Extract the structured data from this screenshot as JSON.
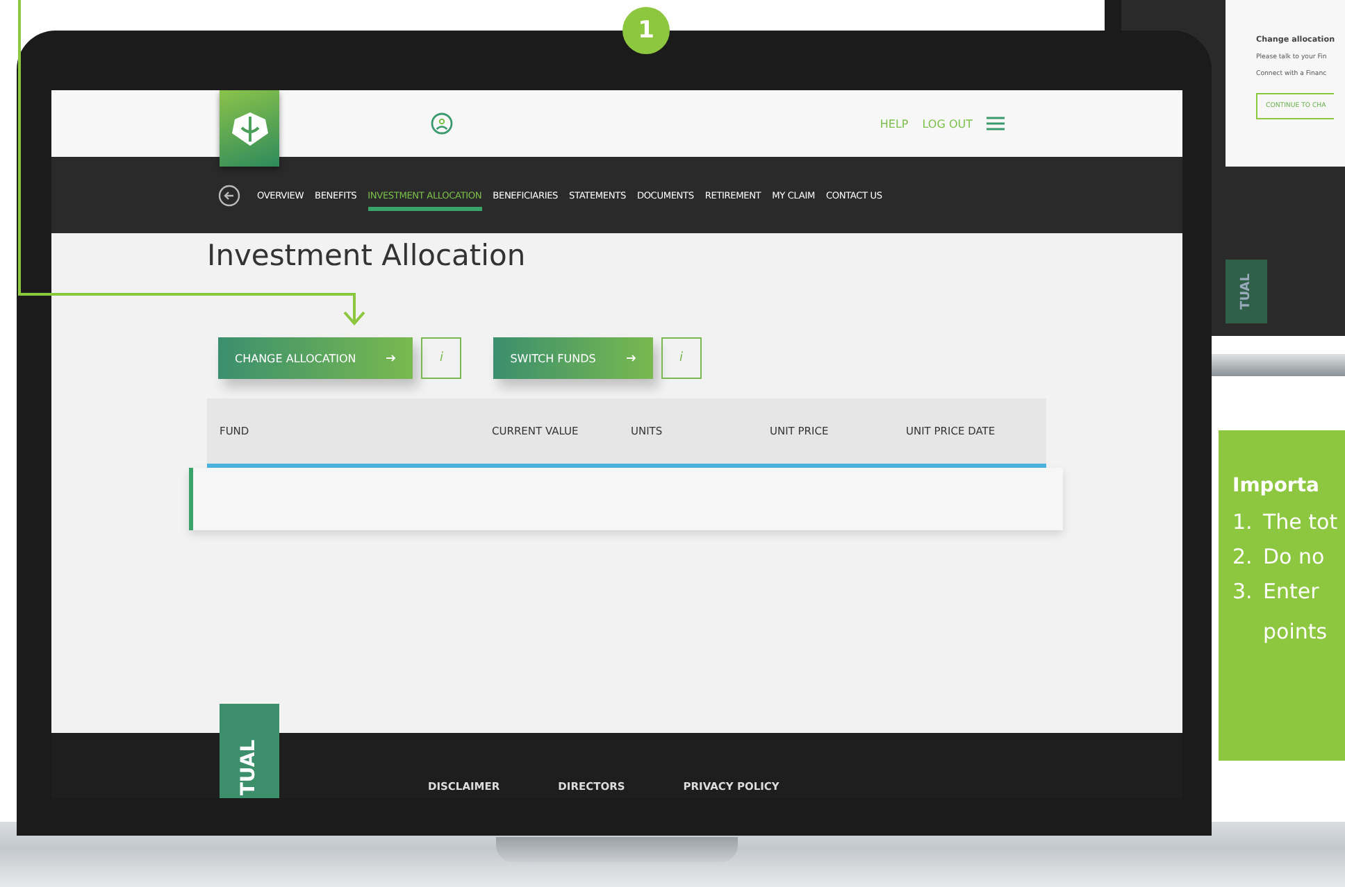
{
  "step_badge": {
    "text": "1"
  },
  "header": {
    "links": [
      {
        "label": "HELP"
      },
      {
        "label": "LOG OUT"
      }
    ]
  },
  "nav": {
    "items": [
      {
        "label": "OVERVIEW",
        "selected": false
      },
      {
        "label": "BENEFITS",
        "selected": false
      },
      {
        "label": "INVESTMENT ALLOCATION",
        "selected": true
      },
      {
        "label": "BENEFICIARIES",
        "selected": false
      },
      {
        "label": "STATEMENTS",
        "selected": false
      },
      {
        "label": "DOCUMENTS",
        "selected": false
      },
      {
        "label": "RETIREMENT",
        "selected": false
      },
      {
        "label": "MY CLAIM",
        "selected": false
      },
      {
        "label": "CONTACT US",
        "selected": false
      }
    ]
  },
  "page_title": "Investment Allocation",
  "actions": [
    {
      "label": "CHANGE ALLOCATION",
      "info": "i"
    },
    {
      "label": "SWITCH FUNDS",
      "info": "i"
    }
  ],
  "table": {
    "columns": [
      "FUND",
      "CURRENT VALUE",
      "UNITS",
      "UNIT PRICE",
      "UNIT PRICE DATE"
    ]
  },
  "brand_tab": "TUAL",
  "footer": {
    "links": [
      "DISCLAIMER",
      "DIRECTORS",
      "PRIVACY POLICY"
    ]
  },
  "second_laptop": {
    "modal": {
      "title": "Change allocation",
      "lines": [
        "Please talk to your Fin",
        "Connect with a Financ"
      ],
      "button": "CONTINUE TO CHA"
    },
    "brand_tab": "TUAL"
  },
  "note": {
    "title": "Importa",
    "items": [
      {
        "number": "1.",
        "lines": [
          "The tot"
        ]
      },
      {
        "number": "2.",
        "lines": [
          "Do no"
        ]
      },
      {
        "number": "3.",
        "lines": [
          "Enter",
          "points"
        ]
      }
    ]
  }
}
